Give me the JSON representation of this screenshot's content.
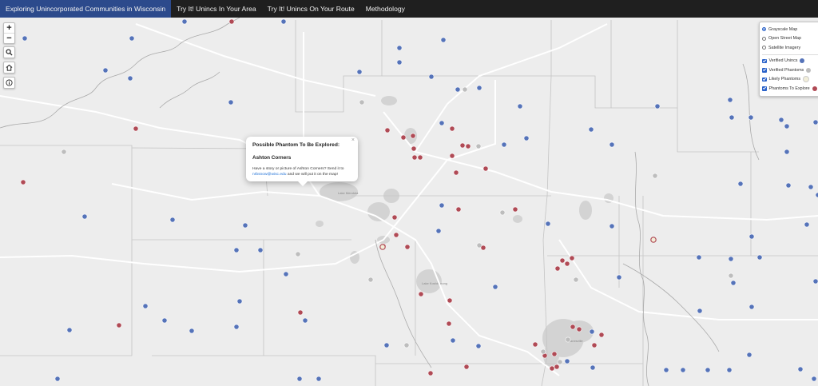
{
  "nav": {
    "items": [
      {
        "label": "Exploring Unincorporated Communities in Wisconsin"
      },
      {
        "label": "Try It! Unincs In Your Area"
      },
      {
        "label": "Try It! Unincs On Your Route"
      },
      {
        "label": "Methodology"
      }
    ]
  },
  "controls": {
    "zoom_in": "+",
    "zoom_out": "−"
  },
  "layers": {
    "basemaps": [
      {
        "label": "Grayscale Map",
        "selected": true
      },
      {
        "label": "Open Street Map",
        "selected": false
      },
      {
        "label": "Satellite Imagery",
        "selected": false
      }
    ],
    "overlays": [
      {
        "label": "Verified Unincs",
        "checked": true,
        "color": "#5573b9"
      },
      {
        "label": "Verified Phantoms",
        "checked": true,
        "color": "#bdbdbd"
      },
      {
        "label": "Likely Phantoms",
        "checked": true,
        "color": "#f2eed9"
      },
      {
        "label": "Phantoms To Explore",
        "checked": true,
        "color": "#b04a55"
      }
    ]
  },
  "popup": {
    "title": "Possible Phantom To Be Explored:",
    "name": "Ashton Corners",
    "message_before": "Have a story or picture of Ashton Corners? Send it to",
    "email": "nrbsnow@wisc.edu",
    "message_after": "and we will put it on the map!",
    "close": "×"
  },
  "map_labels": {
    "lake_1": "Lake Mendota",
    "lake_2": "Lake Koshkonong",
    "city": "Janesville"
  }
}
